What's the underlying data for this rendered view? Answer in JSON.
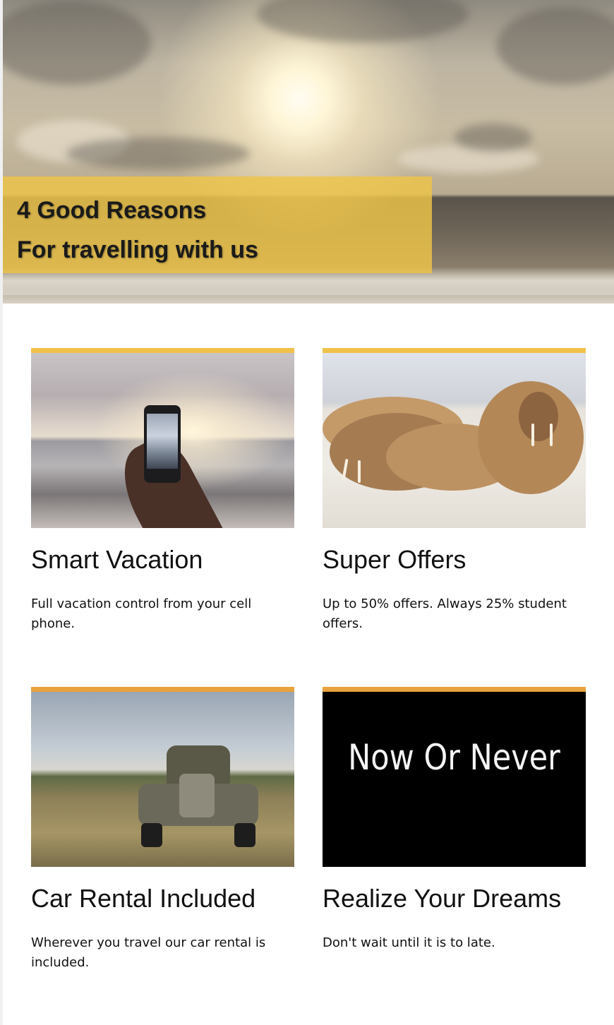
{
  "hero": {
    "line1": "4 Good Reasons",
    "line2": "For travelling with us",
    "banner_color": "#eec448"
  },
  "cards": [
    {
      "title": "Smart Vacation",
      "text": "Full vacation control from your cell phone.",
      "bar_color": "#f0c14a"
    },
    {
      "title": "Super Offers",
      "text": "Up to 50% offers. Always 25% student offers.",
      "bar_color": "#f0c14a"
    },
    {
      "title": "Car Rental Included",
      "text": "Wherever you travel our car rental is included.",
      "bar_color": "#e8a23c"
    },
    {
      "title": "Realize Your Dreams",
      "text": "Don't wait until it is to late.",
      "bar_color": "#e8a23c",
      "image_text": "Now Or Never"
    }
  ]
}
